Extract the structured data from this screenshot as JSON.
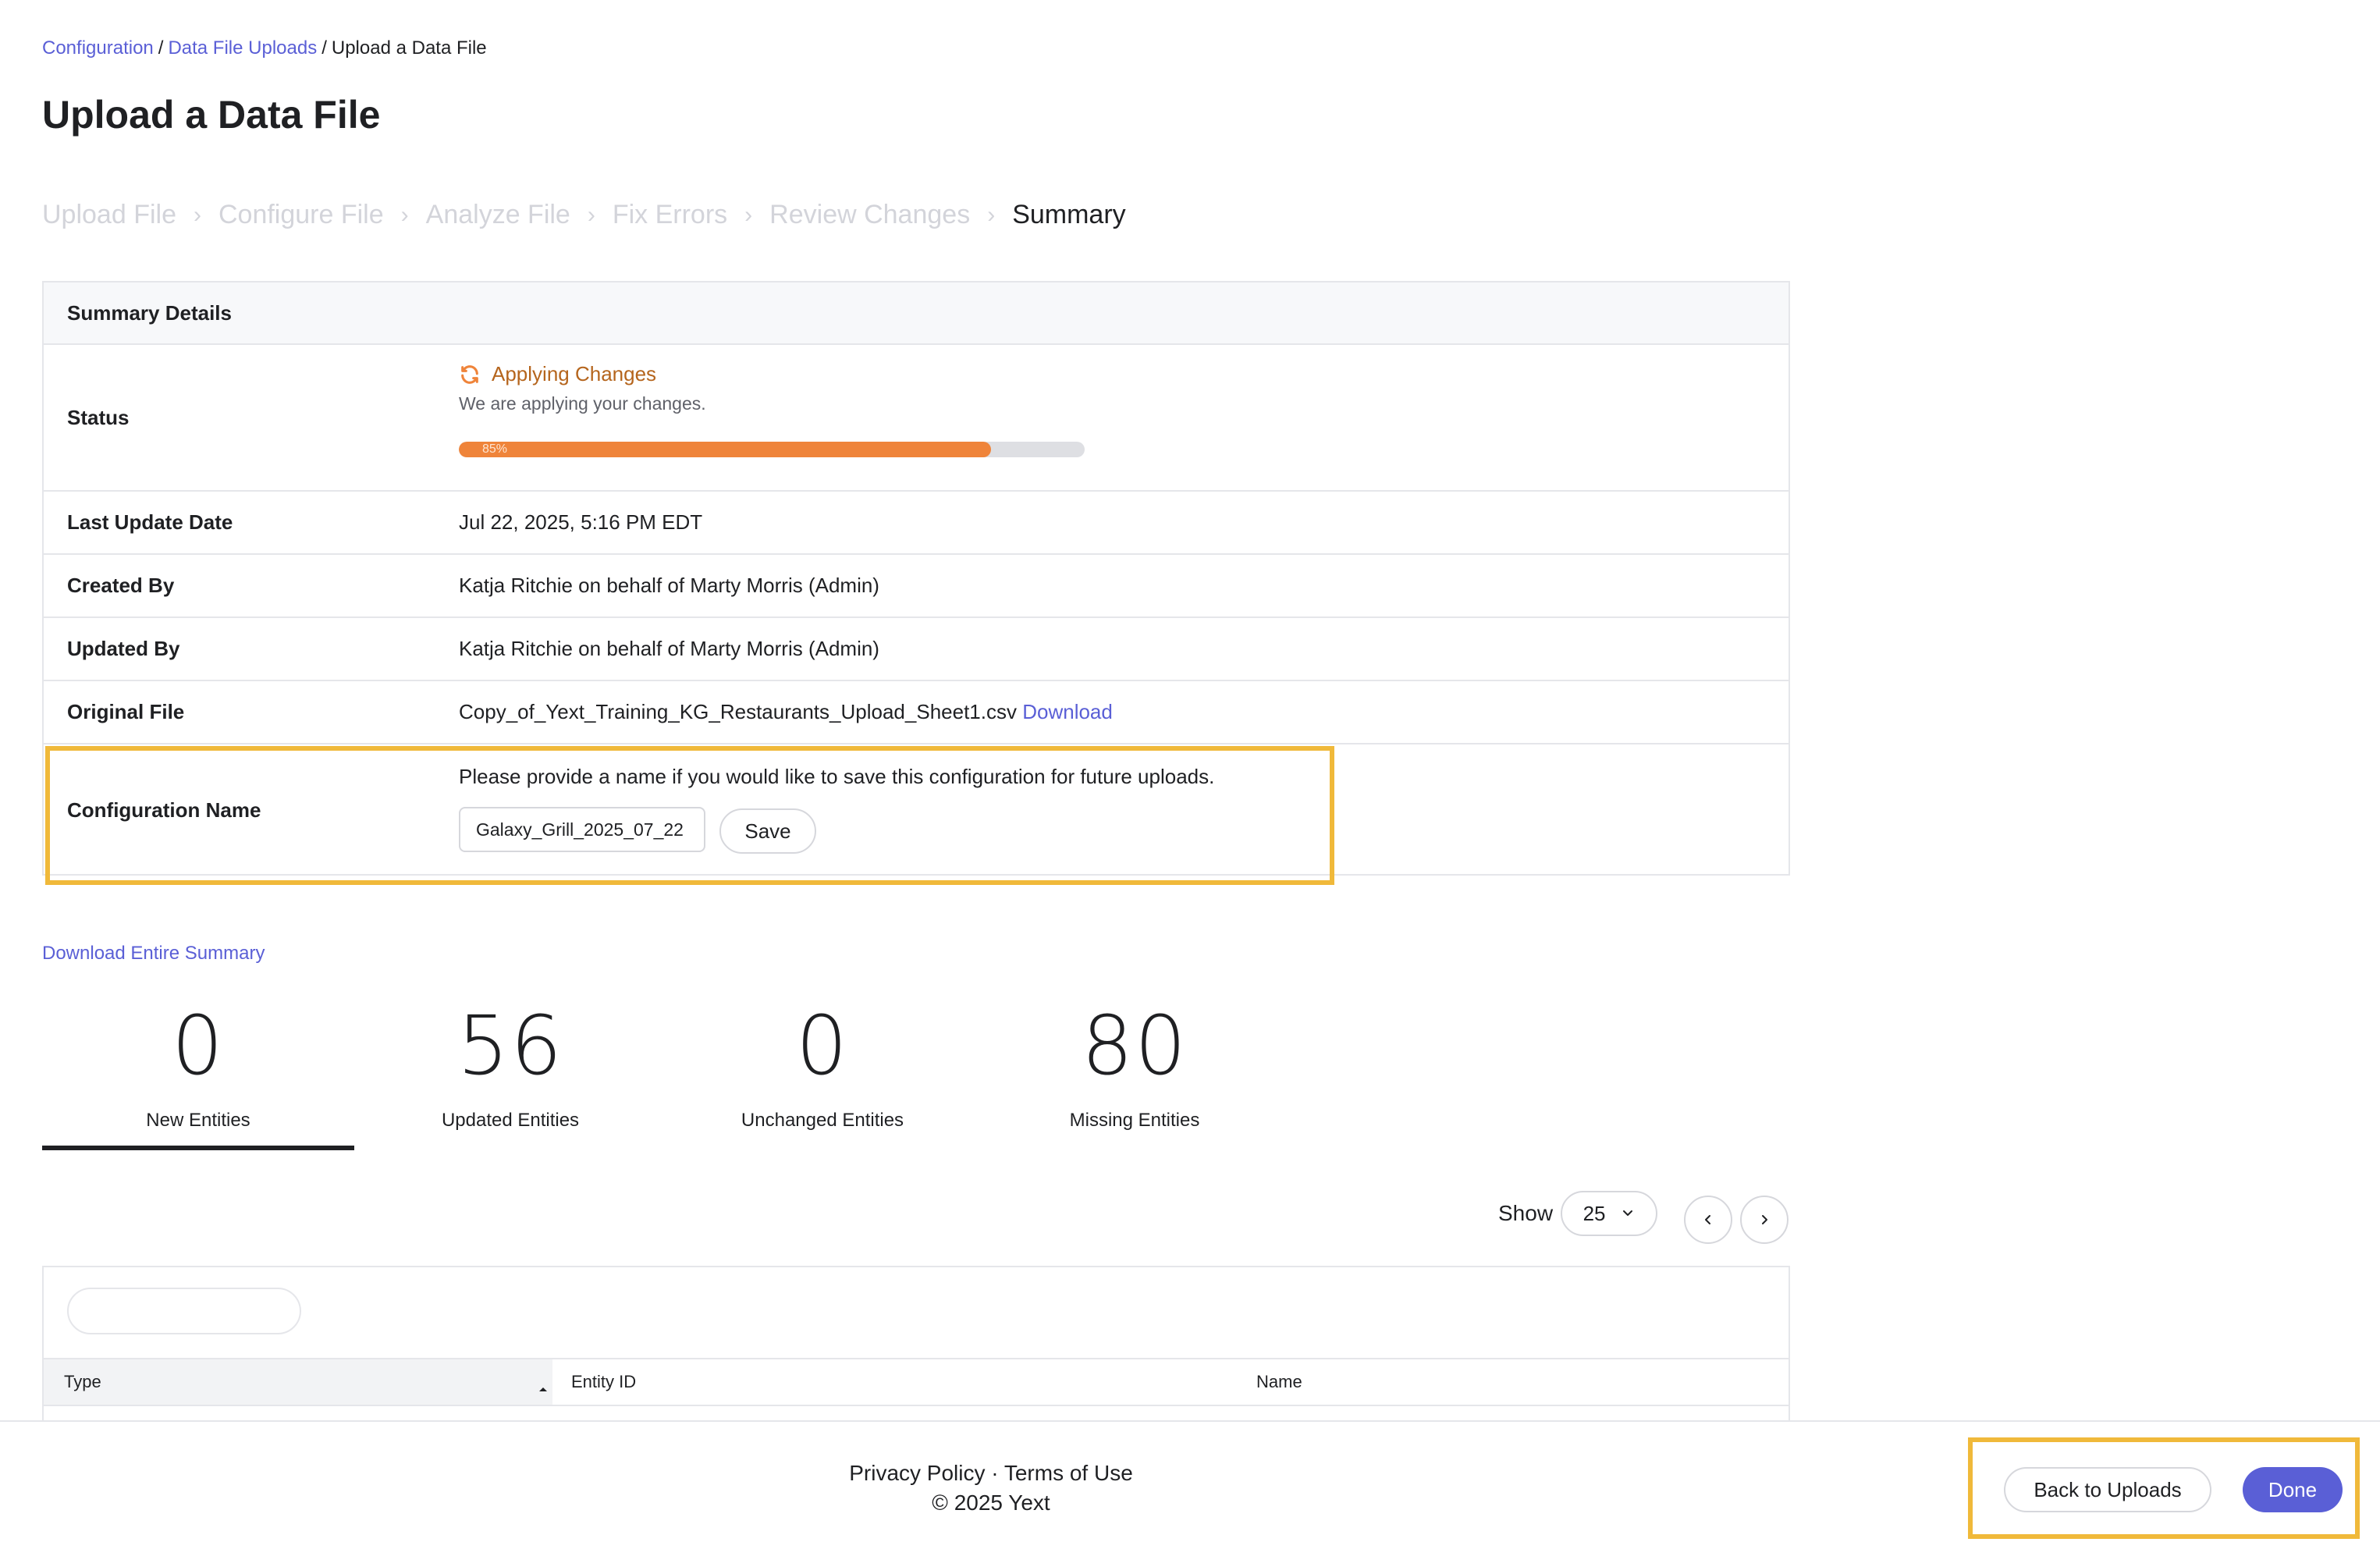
{
  "breadcrumb": {
    "items": [
      {
        "label": "Configuration"
      },
      {
        "label": "Data File Uploads"
      },
      {
        "label": "Upload a Data File"
      }
    ],
    "separator": "/"
  },
  "page_title": "Upload a Data File",
  "steps": {
    "items": [
      "Upload File",
      "Configure File",
      "Analyze File",
      "Fix Errors",
      "Review Changes",
      "Summary"
    ],
    "active_index": 5,
    "separator": "›"
  },
  "summary": {
    "header": "Summary Details",
    "status": {
      "label": "Status",
      "value": "Applying Changes",
      "subtext": "We are applying your changes.",
      "progress_percent": 85,
      "progress_text": "85%",
      "icon": "sync-icon"
    },
    "last_update": {
      "label": "Last Update Date",
      "value": "Jul 22, 2025, 5:16 PM EDT"
    },
    "created_by": {
      "label": "Created By",
      "value": "Katja Ritchie on behalf of Marty Morris (Admin)"
    },
    "updated_by": {
      "label": "Updated By",
      "value": "Katja Ritchie on behalf of Marty Morris (Admin)"
    },
    "original_file": {
      "label": "Original File",
      "value": "Copy_of_Yext_Training_KG_Restaurants_Upload_Sheet1.csv",
      "link": "Download"
    },
    "config_name": {
      "label": "Configuration Name",
      "help": "Please provide a name if you would like to save this configuration for future uploads.",
      "input_value": "Galaxy_Grill_2025_07_22",
      "save_label": "Save"
    }
  },
  "download_summary": "Download Entire Summary",
  "stats": [
    {
      "value": "0",
      "label": "New Entities"
    },
    {
      "value": "56",
      "label": "Updated Entities"
    },
    {
      "value": "0",
      "label": "Unchanged Entities"
    },
    {
      "value": "80",
      "label": "Missing Entities"
    }
  ],
  "pagination": {
    "show_label": "Show",
    "page_size": "25"
  },
  "table": {
    "columns": [
      "Type",
      "Entity ID",
      "Name"
    ]
  },
  "footer": {
    "links": "Privacy Policy · Terms of Use",
    "copyright": "© 2025 Yext"
  },
  "actions": {
    "back_label": "Back to Uploads",
    "done_label": "Done"
  },
  "colors": {
    "accent": "#5a5fd6",
    "progress": "#ef843a",
    "status_text": "#b5651d",
    "highlight": "#f0b93a"
  }
}
